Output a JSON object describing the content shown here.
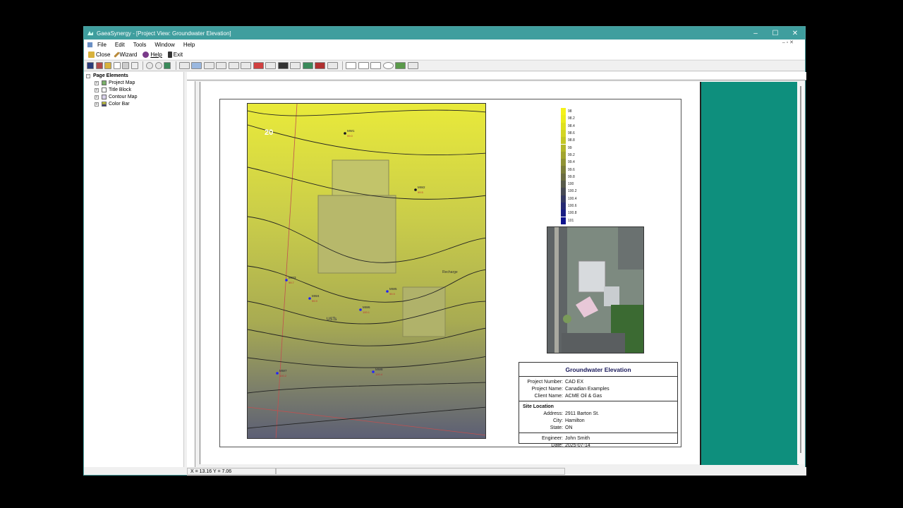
{
  "window": {
    "title": "GaeaSynergy - [Project View: Groundwater Elevation]",
    "controls": [
      "–",
      "☐",
      "✕"
    ]
  },
  "menu": [
    "File",
    "Edit",
    "Tools",
    "Window",
    "Help"
  ],
  "mdi_controls": "‒ ▫ ✕",
  "quickbar": {
    "close": "Close",
    "wizard": "Wizard",
    "help": "Help",
    "exit": "Exit"
  },
  "tree": {
    "root": "Page Elements",
    "items": [
      "Project Map",
      "Title Block",
      "Contour Map",
      "Color Bar"
    ]
  },
  "map": {
    "label_20": "20",
    "wells": [
      {
        "name": "MW1",
        "val": "99.0"
      },
      {
        "name": "MW2",
        "val": "99.5"
      },
      {
        "name": "MW3",
        "val": "99.7"
      },
      {
        "name": "MW4",
        "val": "99.9"
      },
      {
        "name": "MW5",
        "val": "99.9"
      },
      {
        "name": "MW6",
        "val": "100.1"
      },
      {
        "name": "MW7",
        "val": "100.2"
      },
      {
        "name": "MW8",
        "val": "100.4"
      }
    ],
    "texts": [
      "USTs",
      "Recharge"
    ]
  },
  "colorbar": {
    "labels": [
      "98",
      "98.2",
      "98.4",
      "98.6",
      "98.8",
      "99",
      "99.2",
      "99.4",
      "99.6",
      "99.8",
      "100",
      "100.2",
      "100.4",
      "100.6",
      "100.8",
      "101"
    ],
    "colors": [
      "#f5f21a",
      "#eced1c",
      "#dfe11f",
      "#d3d523",
      "#c4c726",
      "#b3b72b",
      "#a2a52f",
      "#8f9234",
      "#7b7e3a",
      "#6a6c42",
      "#585b4b",
      "#474a55",
      "#363a63",
      "#262a73",
      "#191e84",
      "#0f148f"
    ]
  },
  "titleblock": {
    "title": "Groundwater Elevation",
    "project_number_label": "Project Number:",
    "project_number": "CAD EX",
    "project_name_label": "Project Name:",
    "project_name": "Canadian Examples",
    "client_name_label": "Client Name:",
    "client_name": "ACME Oil & Gas",
    "site_location_label": "Site Location",
    "address_label": "Address:",
    "address": "2911 Barton St.",
    "city_label": "City:",
    "city": "Hamilton",
    "state_label": "State:",
    "state": "ON",
    "engineer_label": "Engineer:",
    "engineer": "John Smith",
    "date_label": "Date:",
    "date": "2025-07-14"
  },
  "status": {
    "coords": "X = 13.16  Y = 7.06"
  }
}
